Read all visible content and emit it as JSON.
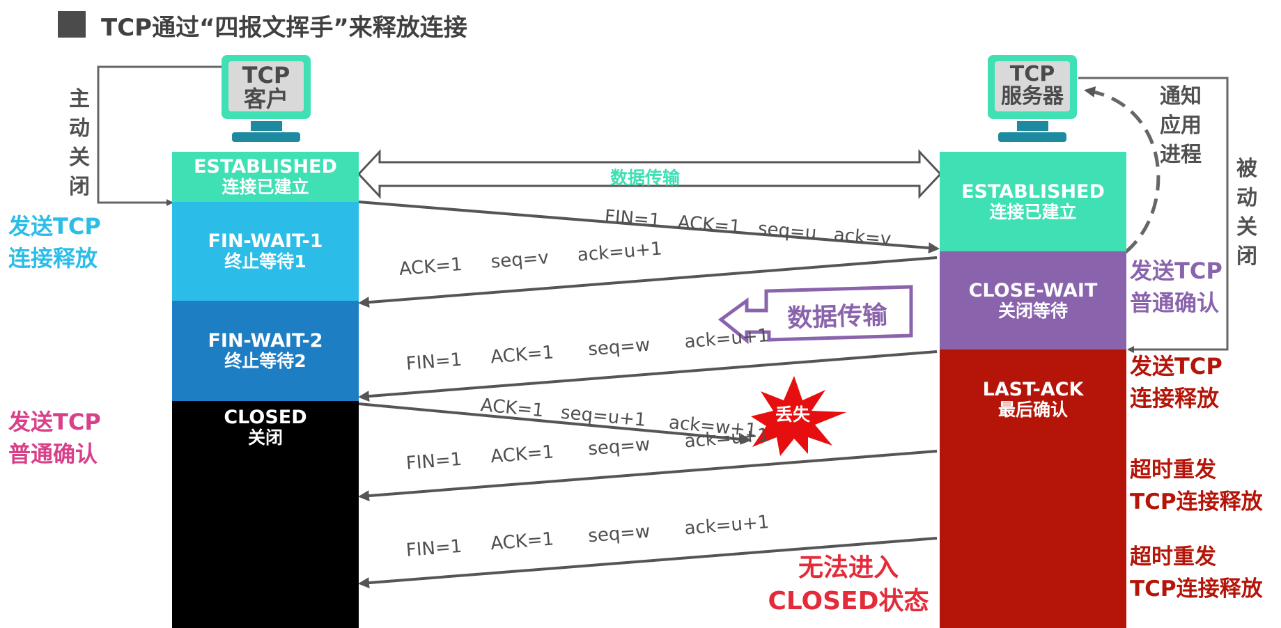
{
  "title": "TCP通过“四报文挥手”来释放连接",
  "client": {
    "monitor": [
      "TCP",
      "客户"
    ],
    "active_close": [
      "主",
      "动",
      "关",
      "闭"
    ],
    "states": [
      {
        "en": "ESTABLISHED",
        "cn": "连接已建立"
      },
      {
        "en": "FIN-WAIT-1",
        "cn": "终止等待1"
      },
      {
        "en": "FIN-WAIT-2",
        "cn": "终止等待2"
      },
      {
        "en": "CLOSED",
        "cn": "关闭"
      }
    ],
    "side_labels": [
      [
        "发送TCP",
        "连接释放"
      ],
      [
        "发送TCP",
        "普通确认"
      ]
    ]
  },
  "server": {
    "monitor": [
      "TCP",
      "服务器"
    ],
    "notify_app": [
      "通知",
      "应用",
      "进程"
    ],
    "passive_close": [
      "被",
      "动",
      "关",
      "闭"
    ],
    "states": [
      {
        "en": "ESTABLISHED",
        "cn": "连接已建立"
      },
      {
        "en": "CLOSE-WAIT",
        "cn": "关闭等待"
      },
      {
        "en": "LAST-ACK",
        "cn": "最后确认"
      }
    ],
    "side_labels": [
      [
        "发送TCP",
        "普通确认"
      ],
      [
        "发送TCP",
        "连接释放"
      ],
      [
        "超时重发",
        "TCP连接释放"
      ],
      [
        "超时重发",
        "TCP连接释放"
      ]
    ]
  },
  "data_transfer": "数据传输",
  "data_transfer_big": "数据传输",
  "messages": [
    "FIN=1   ACK=1   seq=u   ack=v",
    "ACK=1     seq=v     ack=u+1",
    "FIN=1     ACK=1      seq=w      ack=u+1",
    "ACK=1   seq=u+1    ack=w+1",
    "FIN=1     ACK=1      seq=w      ack=u+1",
    "FIN=1     ACK=1      seq=w      ack=u+1"
  ],
  "lost": "丢失",
  "cannot_close": [
    "无法进入",
    "CLOSED状态"
  ],
  "colors": {
    "established": "#3ee0b4",
    "fin_wait_1": "#2bbde8",
    "fin_wait_2": "#1e7ec4",
    "closed": "#000000",
    "close_wait": "#8a63ad",
    "last_ack": "#b51408",
    "cyan_text": "#2bbde8",
    "pink_text": "#d9408a",
    "purple_text": "#8a63ad",
    "red_text": "#b51408",
    "monitor": "#3ee0b4"
  }
}
